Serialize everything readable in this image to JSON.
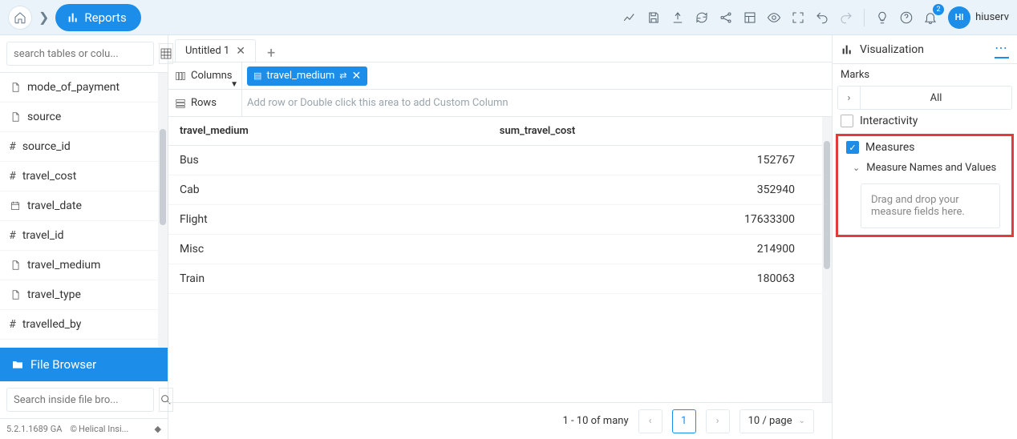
{
  "topbar": {
    "reports_label": "Reports",
    "username": "hiuserv",
    "avatar_initials": "HI",
    "notification_count": "2"
  },
  "sidebar": {
    "search_placeholder": "search tables or colu...",
    "file_browser_label": "File Browser",
    "file_search_placeholder": "Search inside file bro...",
    "version": "5.2.1.1689 GA",
    "copyright": "Helical Insi...",
    "fields": [
      {
        "type": "doc",
        "name": "mode_of_payment"
      },
      {
        "type": "doc",
        "name": "source"
      },
      {
        "type": "hash",
        "name": "source_id"
      },
      {
        "type": "hash",
        "name": "travel_cost"
      },
      {
        "type": "cal",
        "name": "travel_date"
      },
      {
        "type": "hash",
        "name": "travel_id"
      },
      {
        "type": "doc",
        "name": "travel_medium"
      },
      {
        "type": "doc",
        "name": "travel_type"
      },
      {
        "type": "hash",
        "name": "travelled_by"
      }
    ]
  },
  "tabs": {
    "active": "Untitled 1"
  },
  "shelves": {
    "columns_label": "Columns",
    "rows_label": "Rows",
    "column_pill": "travel_medium",
    "rows_placeholder": "Add row or Double click this area to add Custom Column"
  },
  "table": {
    "headers": [
      "travel_medium",
      "sum_travel_cost"
    ],
    "rows": [
      [
        "Bus",
        "152767"
      ],
      [
        "Cab",
        "352940"
      ],
      [
        "Flight",
        "17633300"
      ],
      [
        "Misc",
        "214900"
      ],
      [
        "Train",
        "180063"
      ]
    ]
  },
  "pagination": {
    "info": "1 - 10 of many",
    "page": "1",
    "size": "10 / page"
  },
  "rpanel": {
    "title": "Visualization",
    "marks": "Marks",
    "all": "All",
    "interactivity": "Interactivity",
    "measures": "Measures",
    "measure_names": "Measure Names and Values",
    "drop_hint": "Drag and drop your measure fields here."
  }
}
